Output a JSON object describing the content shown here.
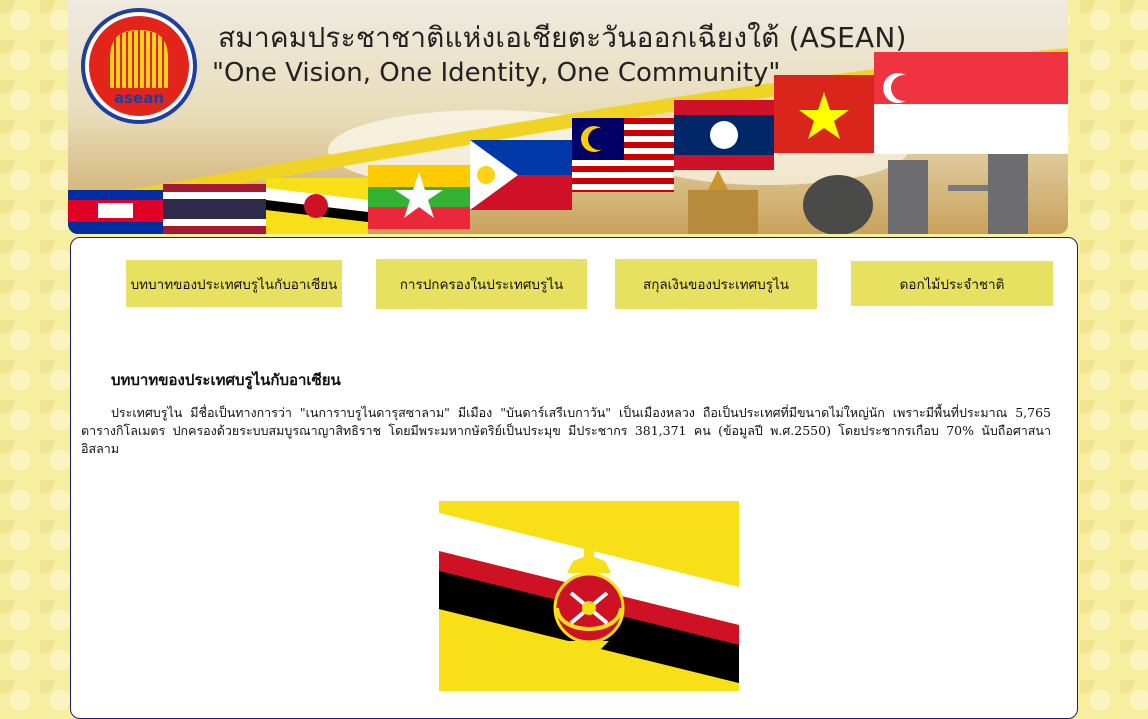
{
  "banner": {
    "title": "สมาคมประชาชาติแห่งเอเชียตะวันออกเฉียงใต้ (ASEAN)",
    "slogan": "\"One Vision, One Identity, One Community\"",
    "logo_text": "asean",
    "flags": [
      "cambodia-flag",
      "thailand-flag",
      "brunei-flag",
      "myanmar-flag",
      "philippines-flag",
      "malaysia-flag",
      "laos-flag",
      "vietnam-flag",
      "singapore-flag"
    ]
  },
  "nav": {
    "items": [
      {
        "label": "บทบาทของประเทศบรูไนกับอาเซียน"
      },
      {
        "label": "การปกครองในประเทศบรูไน"
      },
      {
        "label": "สกุลเงินของประเทศบรูไน"
      },
      {
        "label": "ดอกไม้ประจำชาติ"
      }
    ],
    "button_color": "#e8e060"
  },
  "main": {
    "heading": "บทบาทของประเทศบรูไนกับอาเซียน",
    "paragraph": "ประเทศบรูไน มีชื่อเป็นทางการว่า \"เนการาบรูไนดารุสซาลาม\" มีเมือง \"บันดาร์เสรีเบกาวัน\" เป็นเมืองหลวง ถือเป็นประเทศที่มีขนาดไม่ใหญ่นัก เพราะมีพื้นที่ประมาณ 5,765 ตารางกิโลเมตร ปกครองด้วยระบบสมบูรณาญาสิทธิราช โดยมีพระมหากษัตริย์เป็นประมุข มีประชากร 381,371 คน (ข้อมูลปี พ.ศ.2550) โดยประชากรเกือบ 70% นับถือศาสนาอิสลาม",
    "image": "brunei-flag"
  },
  "colors": {
    "page_background": "#f8eea0",
    "content_border": "#1d1d6e",
    "brunei_yellow": "#f7e017",
    "brunei_red": "#cf1126"
  }
}
